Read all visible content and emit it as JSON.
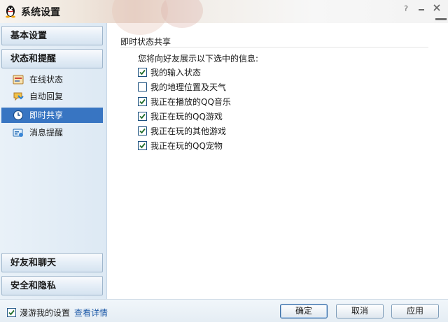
{
  "window": {
    "title": "系统设置"
  },
  "sidebar": {
    "basic": "基本设置",
    "status": "状态和提醒",
    "items": [
      {
        "label": "在线状态",
        "icon": "online-status-icon"
      },
      {
        "label": "自动回复",
        "icon": "auto-reply-icon"
      },
      {
        "label": "即时共享",
        "icon": "clock-icon",
        "selected": true
      },
      {
        "label": "消息提醒",
        "icon": "message-alert-icon"
      }
    ],
    "friends": "好友和聊天",
    "security": "安全和隐私"
  },
  "content": {
    "section_title": "即时状态共享",
    "intro": "您将向好友展示以下选中的信息:",
    "options": [
      {
        "label": "我的输入状态",
        "checked": true
      },
      {
        "label": "我的地理位置及天气",
        "checked": false
      },
      {
        "label": "我正在播放的QQ音乐",
        "checked": true
      },
      {
        "label": "我正在玩的QQ游戏",
        "checked": true
      },
      {
        "label": "我正在玩的其他游戏",
        "checked": true
      },
      {
        "label": "我正在玩的QQ宠物",
        "checked": true
      }
    ]
  },
  "footer": {
    "roam_label": "漫游我的设置",
    "roam_checked": true,
    "roam_link": "查看详情",
    "ok": "确定",
    "cancel": "取消",
    "apply": "应用"
  },
  "colors": {
    "selected_bg": "#3875c2",
    "link": "#1e5aa8"
  }
}
